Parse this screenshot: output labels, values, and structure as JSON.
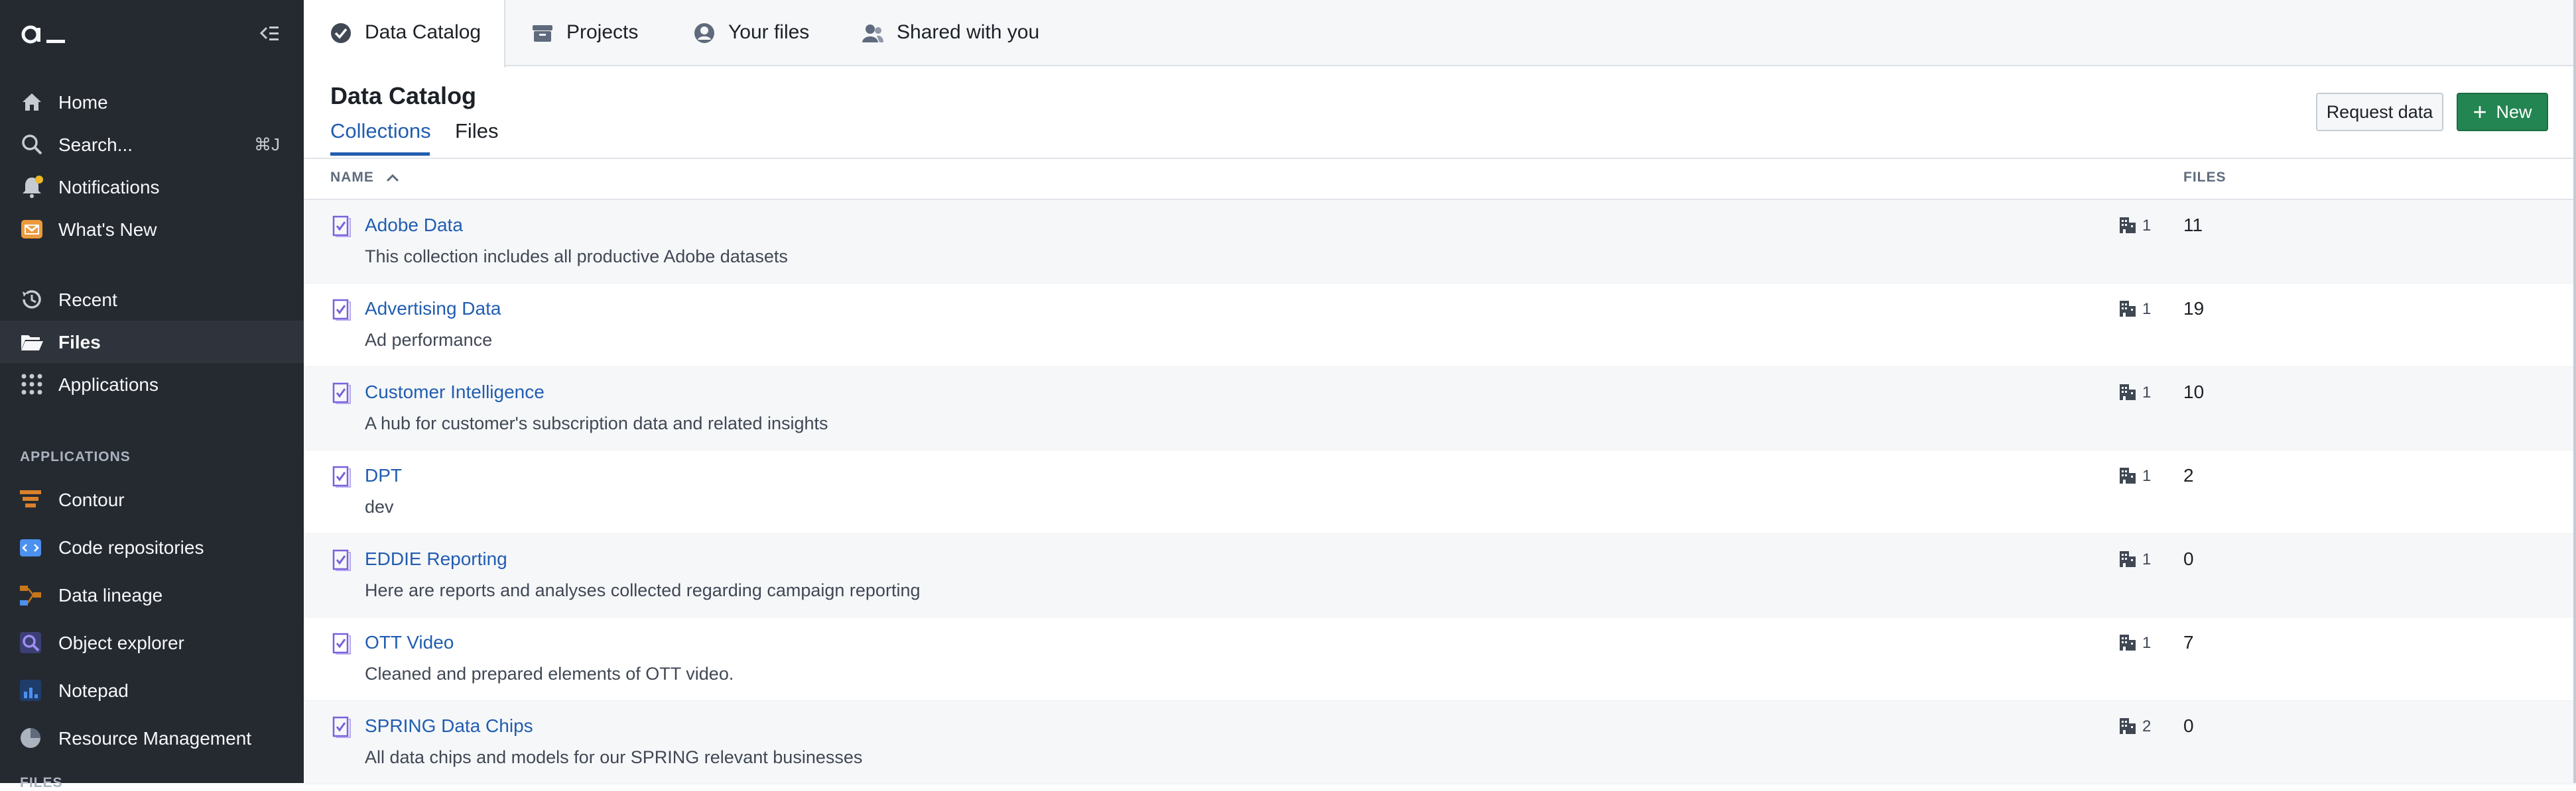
{
  "sidebar": {
    "nav": [
      {
        "label": "Home",
        "icon": "home-icon"
      },
      {
        "label": "Search...",
        "icon": "search-icon",
        "shortcut": "⌘J"
      },
      {
        "label": "Notifications",
        "icon": "bell-icon"
      },
      {
        "label": "What's New",
        "icon": "mail-icon"
      }
    ],
    "nav2": [
      {
        "label": "Recent",
        "icon": "history-icon"
      },
      {
        "label": "Files",
        "icon": "folder-open-icon",
        "active": true
      },
      {
        "label": "Applications",
        "icon": "grid-icon"
      }
    ],
    "applications_title": "APPLICATIONS",
    "apps": [
      {
        "label": "Contour",
        "icon": "contour-icon",
        "color": "#d9822b"
      },
      {
        "label": "Code repositories",
        "icon": "code-repo-icon",
        "color": "#4c90f0"
      },
      {
        "label": "Data lineage",
        "icon": "lineage-icon",
        "color": "#c87619"
      },
      {
        "label": "Object explorer",
        "icon": "object-explorer-icon",
        "color": "#7961db"
      },
      {
        "label": "Notepad",
        "icon": "notepad-icon",
        "color": "#2d72d2"
      },
      {
        "label": "Resource Management",
        "icon": "resource-icon",
        "color": "#abb3bf"
      }
    ],
    "files_title": "FILES"
  },
  "topbar": {
    "tabs": [
      {
        "label": "Data Catalog",
        "icon": "check-circle-icon",
        "active": true
      },
      {
        "label": "Projects",
        "icon": "box-icon"
      },
      {
        "label": "Your files",
        "icon": "user-circle-icon"
      },
      {
        "label": "Shared with you",
        "icon": "people-icon"
      }
    ]
  },
  "header": {
    "title": "Data Catalog",
    "subtabs": [
      "Collections",
      "Files"
    ],
    "request_label": "Request data",
    "new_label": "New"
  },
  "table": {
    "columns": {
      "name": "NAME",
      "files": "FILES"
    },
    "rows": [
      {
        "name": "Adobe Data",
        "desc": "This collection includes all productive Adobe datasets",
        "orgs": "1",
        "files": "11"
      },
      {
        "name": "Advertising Data",
        "desc": "Ad performance",
        "orgs": "1",
        "files": "19"
      },
      {
        "name": "Customer Intelligence",
        "desc": "A hub for customer's subscription data and related insights",
        "orgs": "1",
        "files": "10"
      },
      {
        "name": "DPT",
        "desc": "dev",
        "orgs": "1",
        "files": "2"
      },
      {
        "name": "EDDIE Reporting",
        "desc": "Here are reports and analyses collected regarding campaign reporting",
        "orgs": "1",
        "files": "0"
      },
      {
        "name": "OTT Video",
        "desc": "Cleaned and prepared elements of OTT video.",
        "orgs": "1",
        "files": "7"
      },
      {
        "name": "SPRING Data Chips",
        "desc": "All data chips and models for our SPRING relevant businesses",
        "orgs": "2",
        "files": "0"
      }
    ]
  },
  "colors": {
    "sidebar_bg": "#252a31",
    "accent_blue": "#215db0",
    "new_button": "#238551",
    "notification_dot": "#f0b726"
  }
}
